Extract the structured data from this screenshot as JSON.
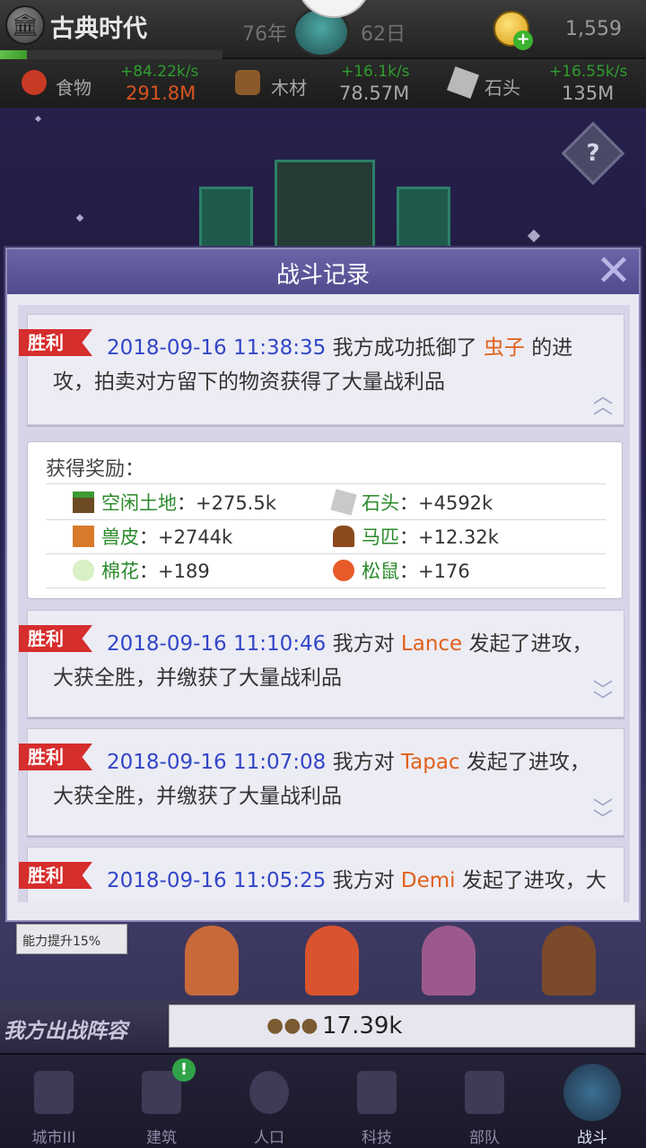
{
  "topbar": {
    "era_title": "古典时代",
    "year": "76年",
    "day": "62日",
    "coins": "1,559"
  },
  "resources": [
    {
      "name": "食物",
      "rate": "+84.22k/s",
      "total": "291.8M",
      "total_color": "#d9531e"
    },
    {
      "name": "木材",
      "rate": "+16.1k/s",
      "total": "78.57M",
      "total_color": "#a8a8a8"
    },
    {
      "name": "石头",
      "rate": "+16.55k/s",
      "total": "135M",
      "total_color": "#a8a8a8"
    }
  ],
  "help_label": "?",
  "modal": {
    "title": "战斗记录",
    "close_label": "✕",
    "entries": [
      {
        "badge": "胜利",
        "timestamp": "2018-09-16 11:38:35",
        "pre": " 我方成功抵御了 ",
        "enemy": "虫子",
        "post": " 的进攻，拍卖对方留下的物资获得了大量战利品",
        "expanded": true
      },
      {
        "badge": "胜利",
        "timestamp": "2018-09-16 11:10:46",
        "pre": " 我方对 ",
        "enemy": "Lance",
        "post": " 发起了进攻，大获全胜，并缴获了大量战利品",
        "expanded": false
      },
      {
        "badge": "胜利",
        "timestamp": "2018-09-16 11:07:08",
        "pre": " 我方对 ",
        "enemy": "Tapac",
        "post": " 发起了进攻，大获全胜，并缴获了大量战利品",
        "expanded": false
      },
      {
        "badge": "胜利",
        "timestamp": "2018-09-16 11:05:25",
        "pre": " 我方对 ",
        "enemy": "Demi",
        "post": " 发起了进攻，大",
        "expanded": false
      }
    ],
    "rewards_title": "获得奖励：",
    "rewards": [
      {
        "name": "空闲土地",
        "value": "：+275.5k",
        "icon": "land-icon"
      },
      {
        "name": "石头",
        "value": "：+4592k",
        "icon": "stone-icon"
      },
      {
        "name": "兽皮",
        "value": "：+2744k",
        "icon": "hide-icon"
      },
      {
        "name": "马匹",
        "value": "：+12.32k",
        "icon": "horse-icon"
      },
      {
        "name": "棉花",
        "value": "：+189",
        "icon": "cotton-icon"
      },
      {
        "name": "松鼠",
        "value": "：+176",
        "icon": "squirrel-icon"
      }
    ]
  },
  "boost_label": "能力提升15%",
  "lineup": {
    "label": "我方出战阵容",
    "power": "17.39k"
  },
  "nav": [
    {
      "label": "城市III",
      "icon": "castle-icon"
    },
    {
      "label": "建筑",
      "icon": "house-icon",
      "alert": "!"
    },
    {
      "label": "人口",
      "icon": "person-icon"
    },
    {
      "label": "科技",
      "icon": "book-icon"
    },
    {
      "label": "部队",
      "icon": "banner-icon"
    },
    {
      "label": "战斗",
      "icon": "crossed-swords-icon",
      "active": true
    }
  ]
}
